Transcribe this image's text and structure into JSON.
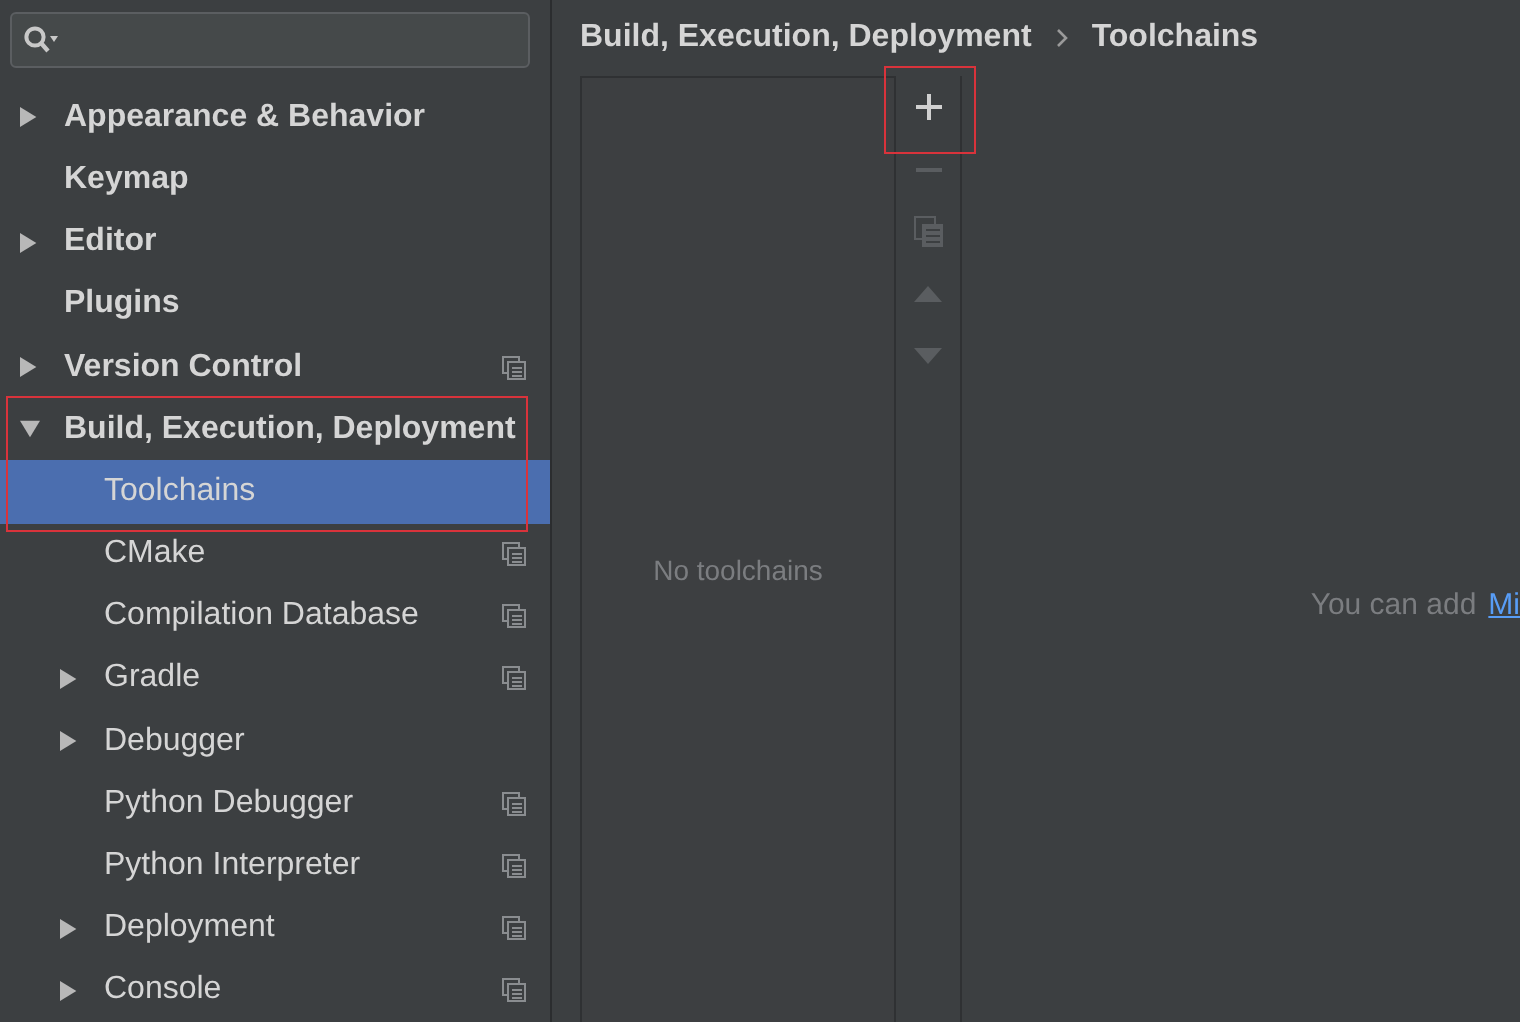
{
  "sidebar": {
    "items": [
      {
        "label": "Appearance & Behavior",
        "expanded": false,
        "project_scope": false,
        "selected": false,
        "outlined": false
      },
      {
        "label": "Keymap",
        "project_scope": false,
        "selected": false,
        "outlined": false
      },
      {
        "label": "Editor",
        "expanded": false,
        "project_scope": false,
        "selected": false,
        "outlined": false
      },
      {
        "label": "Plugins",
        "project_scope": false,
        "selected": false,
        "outlined": false
      },
      {
        "label": "Version Control",
        "expanded": false,
        "project_scope": true,
        "selected": false,
        "outlined": false
      },
      {
        "label": "Build, Execution, Deployment",
        "expanded": true,
        "project_scope": false,
        "selected": false,
        "outlined": true,
        "children": [
          {
            "label": "Toolchains",
            "project_scope": false,
            "selected": true,
            "outlined": false
          },
          {
            "label": "CMake",
            "project_scope": true,
            "selected": false,
            "outlined": false
          },
          {
            "label": "Compilation Database",
            "project_scope": true,
            "selected": false,
            "outlined": false
          },
          {
            "label": "Gradle",
            "expanded": false,
            "project_scope": true,
            "selected": false,
            "outlined": false
          },
          {
            "label": "Debugger",
            "expanded": false,
            "project_scope": false,
            "selected": false,
            "outlined": false
          },
          {
            "label": "Python Debugger",
            "project_scope": true,
            "selected": false,
            "outlined": false
          },
          {
            "label": "Python Interpreter",
            "project_scope": true,
            "selected": false,
            "outlined": false
          },
          {
            "label": "Deployment",
            "expanded": false,
            "project_scope": true,
            "selected": false,
            "outlined": false
          },
          {
            "label": "Console",
            "expanded": false,
            "project_scope": true,
            "selected": false,
            "outlined": false
          }
        ]
      }
    ]
  },
  "breadcrumb": [
    "Build, Execution, Deployment",
    "Toolchains"
  ],
  "toolchains": {
    "empty_text": "No toolchains",
    "toolbar": [
      {
        "kind": "add",
        "disabled": false,
        "outlined": true
      },
      {
        "kind": "remove",
        "disabled": true,
        "outlined": false
      },
      {
        "kind": "copy",
        "disabled": true,
        "outlined": false
      },
      {
        "kind": "up",
        "disabled": true,
        "outlined": false
      },
      {
        "kind": "down",
        "disabled": true,
        "outlined": false
      }
    ]
  },
  "hint": {
    "text": "You can add",
    "link": "Mi"
  }
}
